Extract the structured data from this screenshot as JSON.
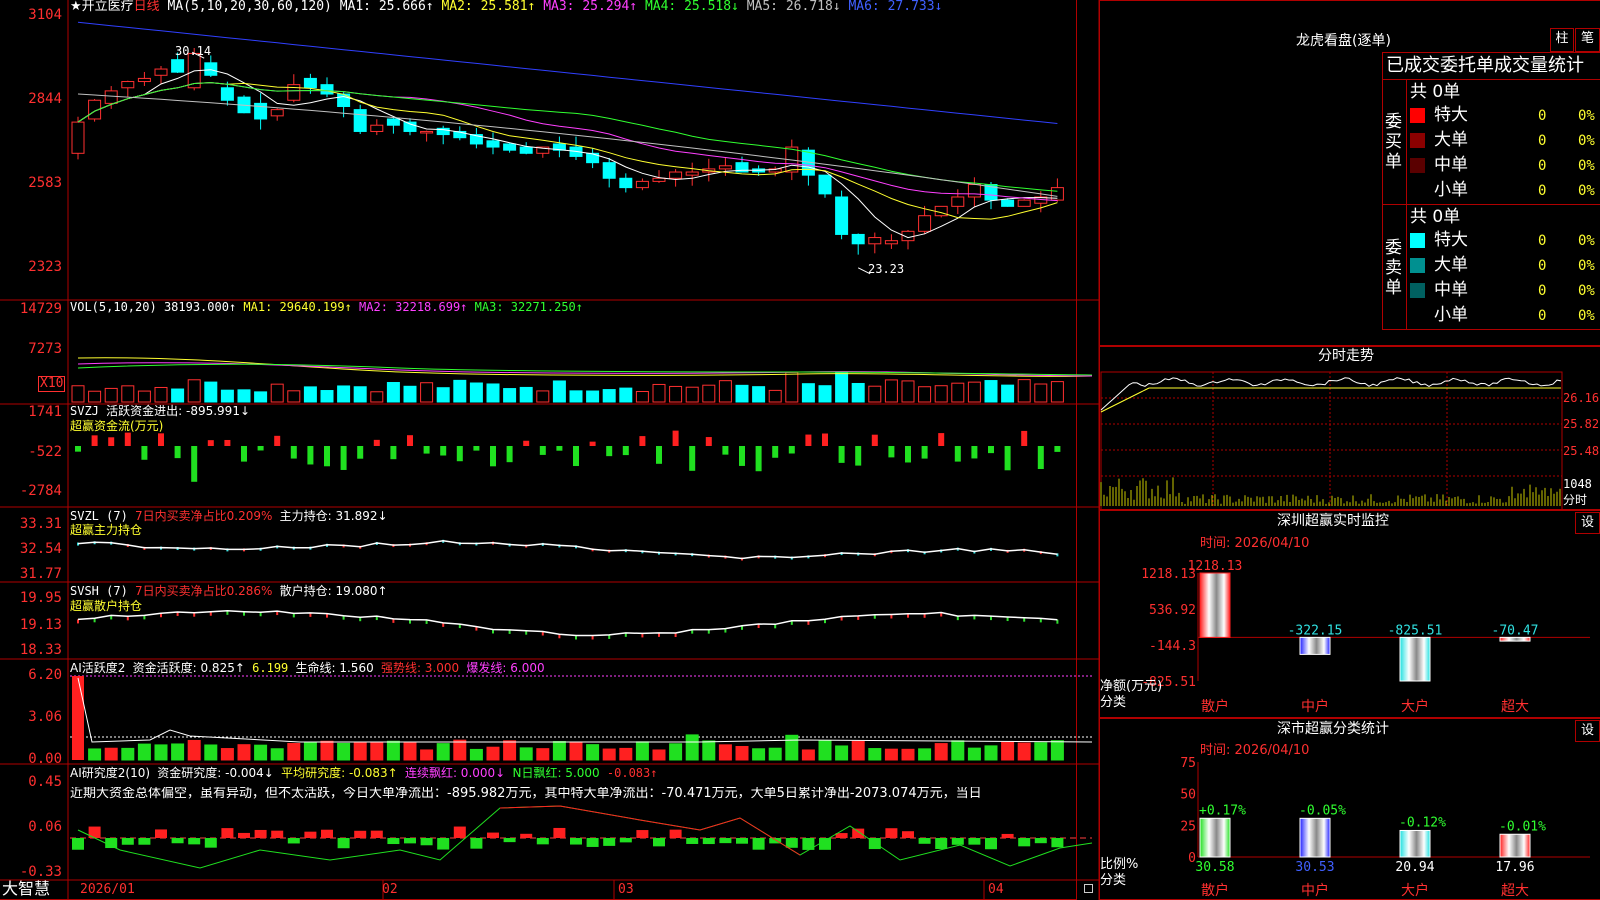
{
  "colors": {
    "up": "#ff3030",
    "down": "#00ffff",
    "ma1": "#ffffff",
    "ma2": "#ffff30",
    "ma3": "#ff40ff",
    "ma4": "#30ff30",
    "ma5": "#c0c0c0",
    "ma6": "#3040ff",
    "frame": "#b00000"
  },
  "header": {
    "star": "★开立医疗",
    "period": "日线",
    "ma_params": "MA(5,10,20,30,60,120)",
    "ma1": "MA1: 25.666↑",
    "ma2": "MA2: 25.581↑",
    "ma3": "MA3: 25.294↑",
    "ma4": "MA4: 25.518↓",
    "ma5": "MA5: 26.718↓",
    "ma6": "MA6: 27.733↓"
  },
  "price_axis": [
    "3104",
    "2844",
    "2583",
    "2323"
  ],
  "annotations": {
    "high": "30.14",
    "low": "23.23"
  },
  "vol": {
    "title": "VOL(5,10,20)",
    "value": "38193.000↑",
    "ma1": "MA1: 29640.199↑",
    "ma2": "MA2: 32218.699↑",
    "ma3": "MA3: 32271.250↑",
    "axis": [
      "14729",
      "7273"
    ],
    "unit": "X10"
  },
  "svzj": {
    "title": "SVZJ",
    "label": "活跃资金进出: -895.991↓",
    "sub": "超赢资金流(万元)",
    "axis": [
      "1741",
      "-522",
      "-2784"
    ]
  },
  "svzl": {
    "title": "SVZL (7)",
    "label1": "7日内买卖净占比0.209%",
    "label2": "主力持仓: 31.892↓",
    "sub": "超赢主力持仓",
    "axis": [
      "33.31",
      "32.54",
      "31.77"
    ]
  },
  "svsh": {
    "title": "SVSH (7)",
    "label1": "7日内买卖净占比0.286%",
    "label2": "散户持仓: 19.080↑",
    "sub": "超赢散户持仓",
    "axis": [
      "19.95",
      "19.13",
      "18.33"
    ]
  },
  "ai1": {
    "title": "AI活跃度2",
    "label1": "资金活跃度: 0.825↑",
    "label2": "6.199",
    "label3": "生命线: 1.560",
    "label4": "强势线: 3.000",
    "label5": "爆发线: 6.000",
    "axis": [
      "6.20",
      "3.06",
      "0.00"
    ]
  },
  "ai2": {
    "title": "AI研究度2(10)",
    "label1": "资金研究度: -0.004↓",
    "label2": "平均研究度: -0.083↑",
    "label3": "连续飘红: 0.000↓",
    "label4": "N日飘红: 5.000",
    "label5": "-0.083↑",
    "comment": "近期大资金总体偏空，虽有异动，但不太活跃，今日大单净流出：-895.982万元，其中特大单净流出：-70.471万元，大单5日累计净出-2073.074万元，当日",
    "axis": [
      "0.45",
      "0.06",
      "-0.33"
    ]
  },
  "footer": {
    "brand": "大智慧",
    "dates": [
      "2026/01",
      "02",
      "03",
      "04"
    ]
  },
  "lhb": {
    "title": "龙虎看盘(逐单)",
    "btn1": "柱",
    "btn2": "笔",
    "subtitle": "已成交委托单成交量统计",
    "buy_side": "委买单",
    "sell_side": "委卖单",
    "buy_total": "共 0单",
    "sell_total": "共 0单",
    "buy": [
      {
        "name": "特大",
        "vol": "0",
        "pct": "0%",
        "color": "#ff0000"
      },
      {
        "name": "大单",
        "vol": "0",
        "pct": "0%",
        "color": "#8b0000"
      },
      {
        "name": "中单",
        "vol": "0",
        "pct": "0%",
        "color": "#5a0000"
      },
      {
        "name": "小单",
        "vol": "0",
        "pct": "0%",
        "color": "#000000"
      }
    ],
    "sell": [
      {
        "name": "特大",
        "vol": "0",
        "pct": "0%",
        "color": "#00ffff"
      },
      {
        "name": "大单",
        "vol": "0",
        "pct": "0%",
        "color": "#009090"
      },
      {
        "name": "中单",
        "vol": "0",
        "pct": "0%",
        "color": "#006060"
      },
      {
        "name": "小单",
        "vol": "0",
        "pct": "0%",
        "color": "#000000"
      }
    ]
  },
  "intraday": {
    "title": "分时走势",
    "prices": [
      "26.16",
      "25.82",
      "25.48"
    ],
    "vol": "1048",
    "vol_unit": "分时"
  },
  "monitor": {
    "title": "深圳超赢实时监控",
    "btn": "设",
    "time": "时间: 2026/04/10",
    "axis": [
      "1218.13",
      "536.92",
      "-144.3",
      "-825.51"
    ],
    "ylabel": "净额(万元)",
    "xlabel": "分类"
  },
  "classify": {
    "title": "深市超赢分类统计",
    "btn": "设",
    "time": "时间: 2026/04/10",
    "axis": [
      "75",
      "50",
      "25",
      "0"
    ],
    "ylabel": "比例%",
    "xlabel": "分类"
  },
  "chart_data": [
    {
      "type": "bar",
      "title": "深圳超赢实时监控",
      "categories": [
        "散户",
        "中户",
        "大户",
        "超大"
      ],
      "values": [
        1218.13,
        -322.15,
        -825.51,
        -70.47
      ],
      "labels": [
        "1218.13",
        "-322.15",
        "-825.51",
        "-70.47"
      ],
      "ylim": [
        -825.51,
        1218.13
      ],
      "ylabel": "净额(万元)",
      "xlabel": "分类"
    },
    {
      "type": "bar",
      "title": "深市超赢分类统计",
      "categories": [
        "散户",
        "中户",
        "大户",
        "超大"
      ],
      "values": [
        30.58,
        30.53,
        20.94,
        17.96
      ],
      "labels": [
        "30.58",
        "30.53",
        "20.94",
        "17.96"
      ],
      "changes": [
        "+0.17%",
        "-0.05%",
        "-0.12%",
        "-0.01%"
      ],
      "ylim": [
        0,
        75
      ],
      "ylabel": "比例%",
      "xlabel": "分类"
    }
  ]
}
